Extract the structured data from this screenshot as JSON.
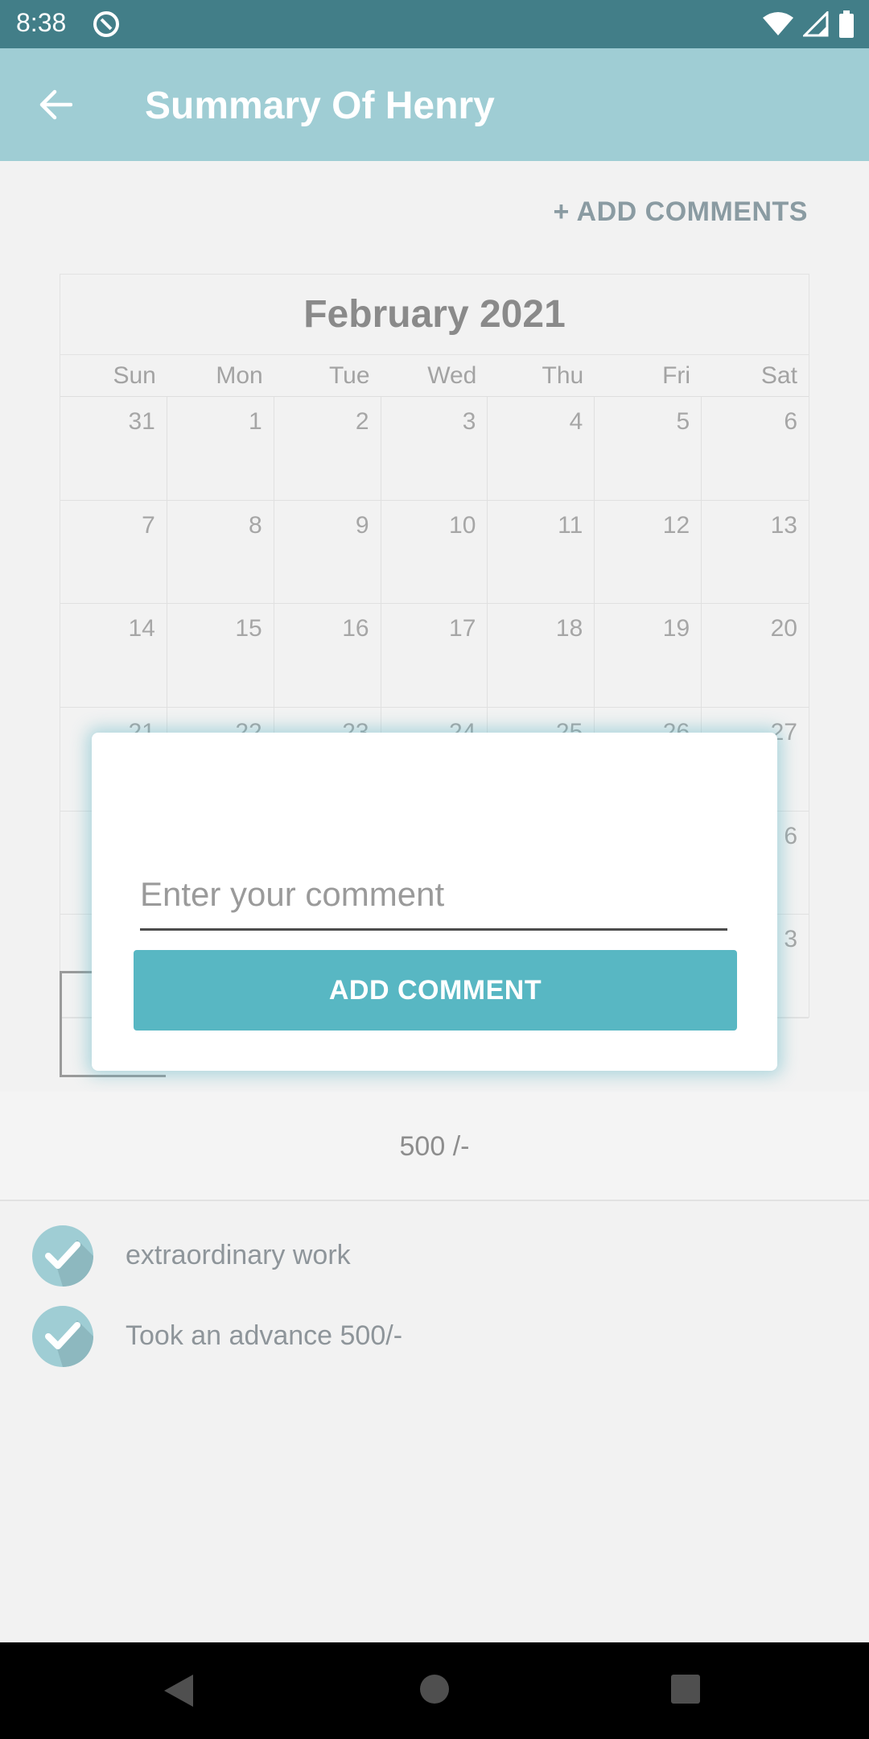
{
  "status_bar": {
    "time": "8:38",
    "app_icon": "notification-app-icon",
    "icons": [
      "wifi-icon",
      "signal-icon",
      "battery-icon"
    ]
  },
  "app_bar": {
    "title": "Summary Of Henry",
    "back_icon": "arrow-left-icon"
  },
  "add_comments_link": "+ ADD COMMENTS",
  "calendar": {
    "title": "February 2021",
    "weekdays": [
      "Sun",
      "Mon",
      "Tue",
      "Wed",
      "Thu",
      "Fri",
      "Sat"
    ],
    "days": [
      "31",
      "1",
      "2",
      "3",
      "4",
      "5",
      "6",
      "7",
      "8",
      "9",
      "10",
      "11",
      "12",
      "13",
      "14",
      "15",
      "16",
      "17",
      "18",
      "19",
      "20",
      "21",
      "22",
      "23",
      "24",
      "25",
      "26",
      "27",
      "",
      "",
      "",
      "",
      "",
      "",
      "6",
      "",
      "",
      "",
      "",
      "",
      "",
      "3"
    ]
  },
  "amount": "500 /-",
  "comments": [
    {
      "text": "extraordinary work",
      "icon": "check-circle-icon"
    },
    {
      "text": "Took an advance 500/-",
      "icon": "check-circle-icon"
    }
  ],
  "dialog": {
    "input_placeholder": "Enter your comment",
    "input_value": "",
    "button_label": "ADD COMMENT"
  },
  "colors": {
    "status_bar": "#427e88",
    "app_bar": "#9fcdd4",
    "button": "#58b7c3"
  }
}
